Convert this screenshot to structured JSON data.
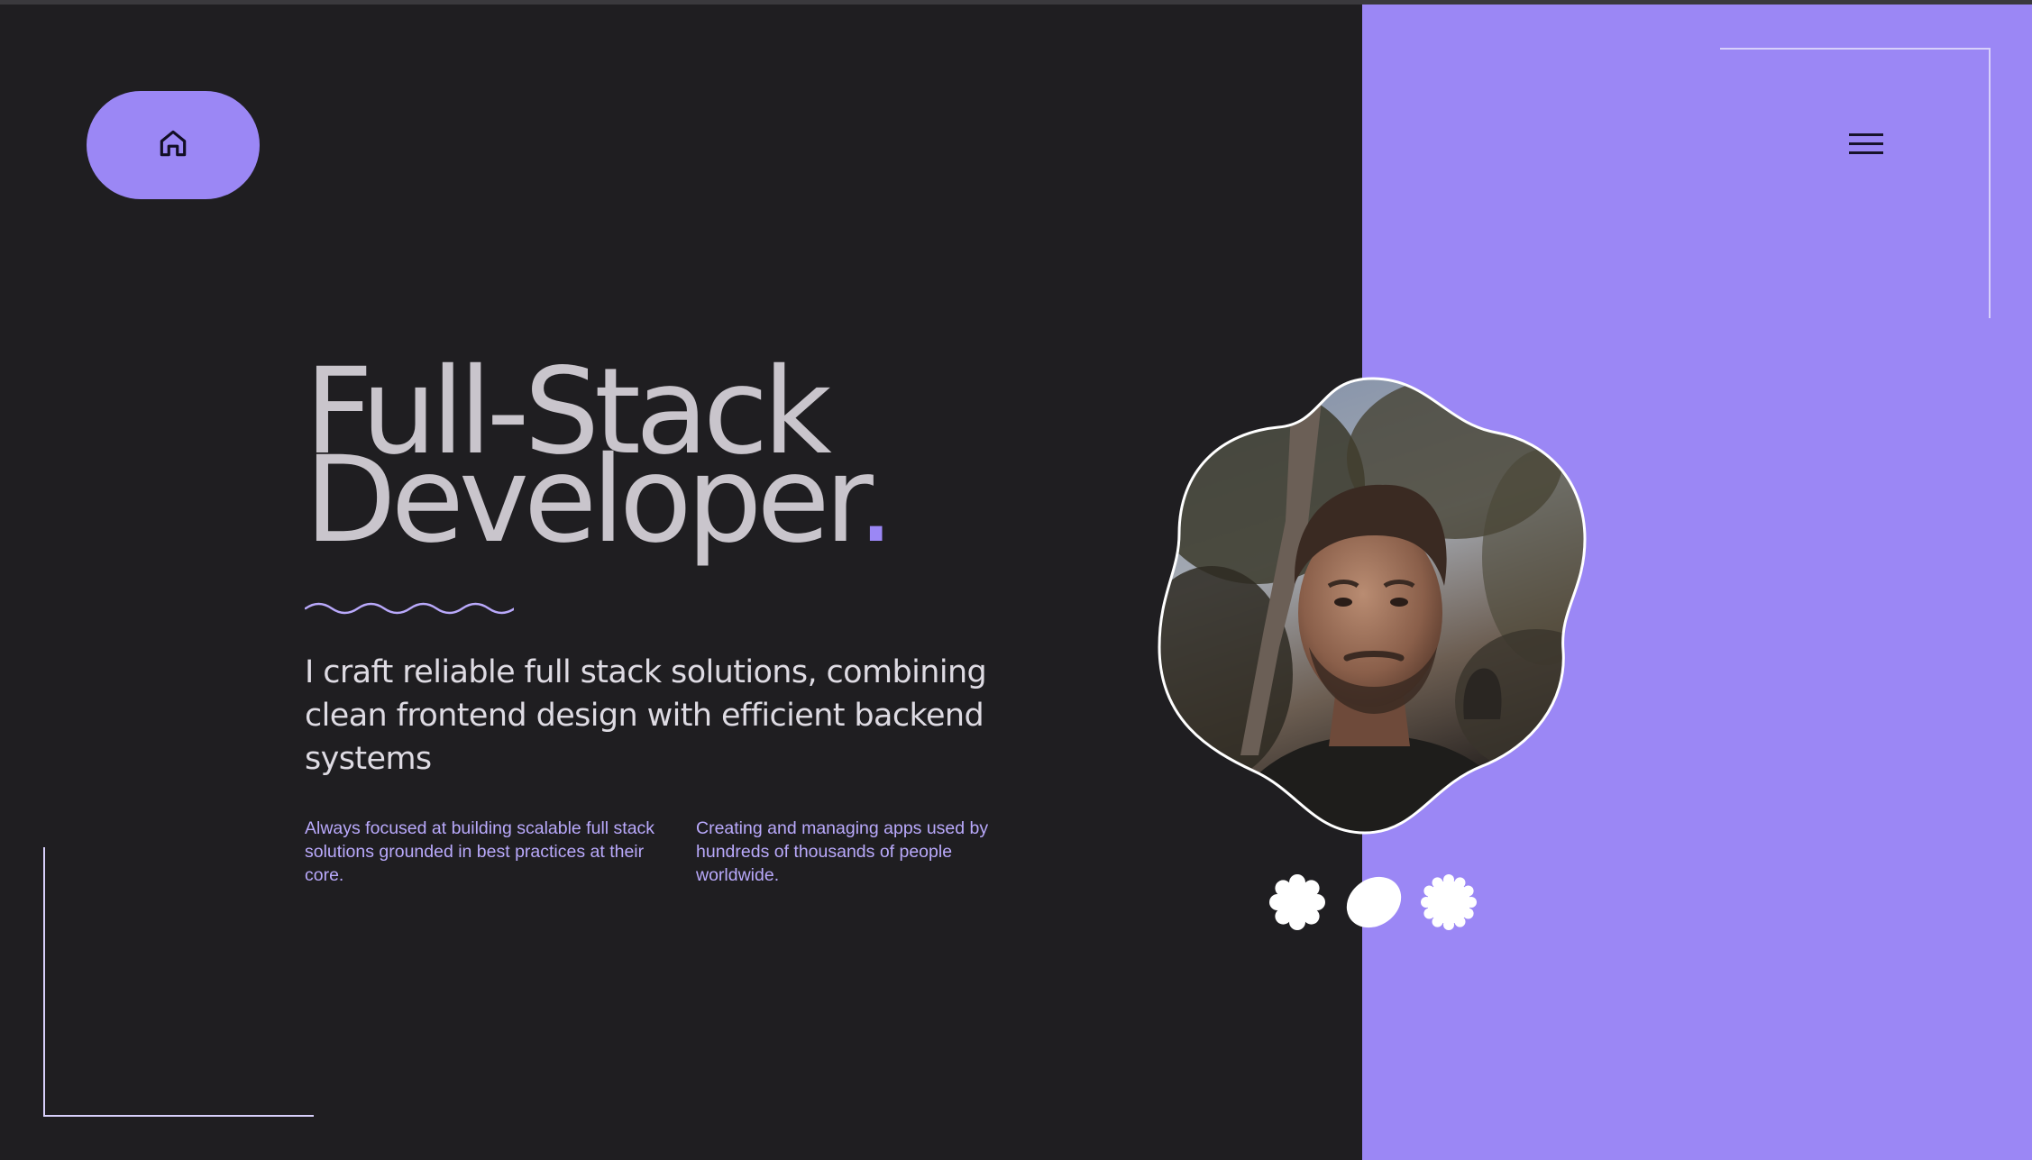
{
  "nav": {
    "home_icon": "home-icon",
    "menu_icon": "menu-icon"
  },
  "hero": {
    "title_line1": "Full-Stack",
    "title_line2": "Developer",
    "title_dot": ".",
    "subtitle": "I craft reliable full stack solutions, combining clean frontend design with efficient backend systems"
  },
  "details": [
    {
      "text": "Always focused at building scalable full stack solutions grounded in best practices at their core."
    },
    {
      "text": "Creating and managing apps used by hundreds of thousands of people worldwide."
    }
  ],
  "photo": {
    "alt": "Profile photo"
  },
  "shape_options": [
    {
      "icon": "scalloped-flower-icon"
    },
    {
      "icon": "leaf-blob-icon"
    },
    {
      "icon": "star-flower-icon"
    }
  ],
  "colors": {
    "background_dark": "#1f1e21",
    "accent": "#9b87f5",
    "title": "#c9c5cc",
    "detail_text": "#b9a9fb",
    "corner_lines": "#d8d0fb"
  }
}
